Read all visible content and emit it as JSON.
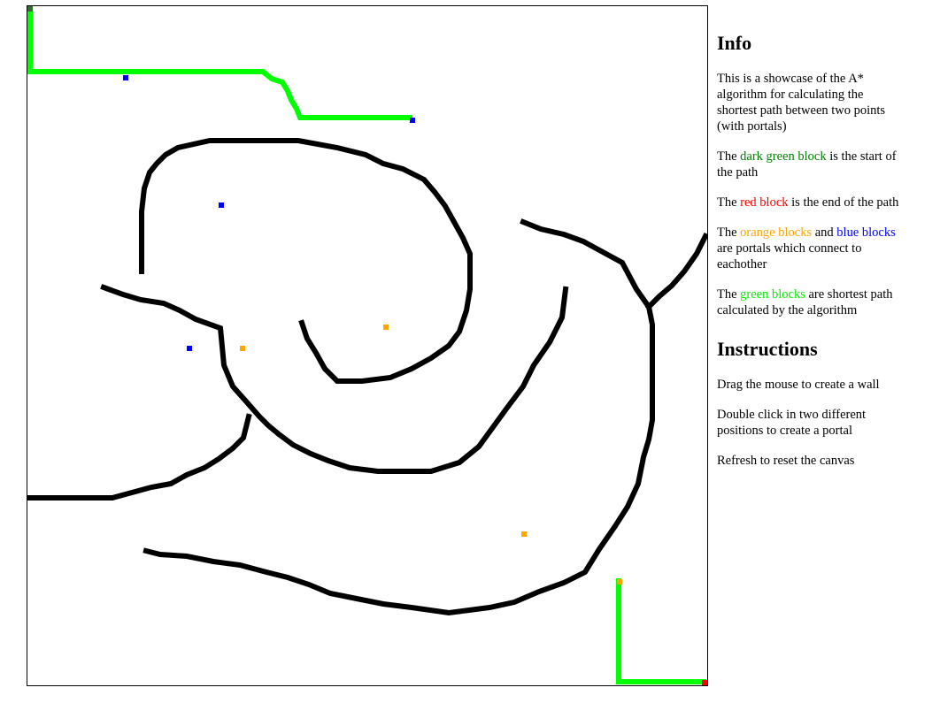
{
  "colors": {
    "wall": "#000000",
    "start": "#2f6e2f",
    "end": "#ff0000",
    "path": "#00ff00",
    "portal_orange": "#ffa500",
    "portal_blue": "#0000ff",
    "background": "#ffffff"
  },
  "info": {
    "title": "Info",
    "intro": "This is a showcase of the A* algorithm for calculating the shortest path between two points (with portals)",
    "p2": {
      "before": "The ",
      "hl": "dark green block",
      "after": " is the start of the path"
    },
    "p3": {
      "before": "The ",
      "hl": "red block",
      "after": " is the end of the path"
    },
    "p4": {
      "before": "The ",
      "hl1": "orange blocks",
      "mid": " and ",
      "hl2": "blue blocks",
      "after": " are portals which connect to eachother"
    },
    "p5": {
      "before": "The ",
      "hl": "green blocks",
      "after": " are shortest path calculated by the algorithm"
    }
  },
  "instructions": {
    "title": "Instructions",
    "items": [
      "Drag the mouse to create a wall",
      "Double click in two different positions to create a portal",
      "Refresh to reset the canvas"
    ]
  }
}
